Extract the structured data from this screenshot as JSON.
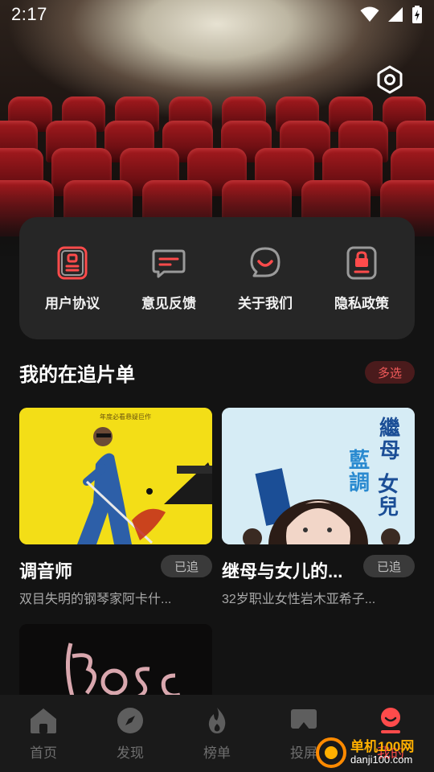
{
  "status_bar": {
    "time": "2:17"
  },
  "menu": [
    {
      "label": "用户协议",
      "icon": "user-agreement-icon"
    },
    {
      "label": "意见反馈",
      "icon": "feedback-icon"
    },
    {
      "label": "关于我们",
      "icon": "about-us-icon"
    },
    {
      "label": "隐私政策",
      "icon": "privacy-policy-icon"
    }
  ],
  "section": {
    "title": "我的在追片单",
    "multi_select": "多选"
  },
  "cards": [
    {
      "title": "调音师",
      "badge": "已追",
      "desc": "双目失明的钢琴家阿卡什..."
    },
    {
      "title": "继母与女儿的...",
      "badge": "已追",
      "desc": "32岁职业女性岩木亚希子..."
    },
    {
      "title": "",
      "badge": "",
      "desc": ""
    }
  ],
  "poster_text": {
    "p2_title": "繼母與女兒的藍調"
  },
  "nav": [
    {
      "label": "首页",
      "icon": "home-icon"
    },
    {
      "label": "发现",
      "icon": "compass-icon"
    },
    {
      "label": "榜单",
      "icon": "flame-icon"
    },
    {
      "label": "投屏",
      "icon": "cast-icon"
    },
    {
      "label": "我的",
      "icon": "profile-icon"
    }
  ],
  "active_nav": "我的",
  "watermark": {
    "title": "单机100网",
    "url": "danji100.com"
  },
  "colors": {
    "accent": "#ff4b4b",
    "background": "#131313",
    "card": "#262626"
  }
}
